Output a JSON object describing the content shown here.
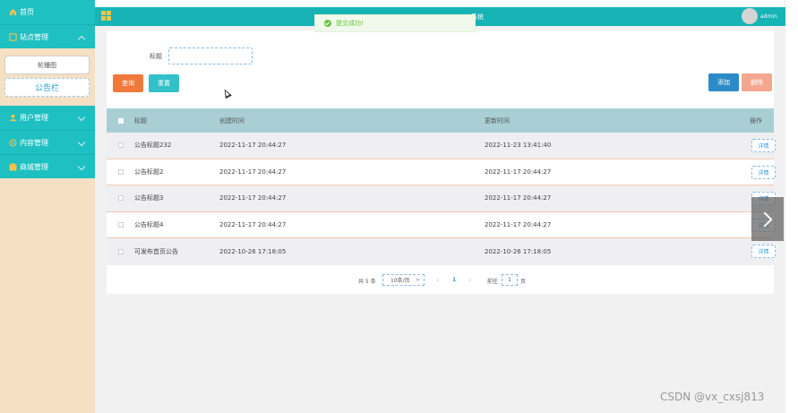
{
  "sidebar": {
    "home": {
      "label": "首页",
      "icon": "home-icon"
    },
    "site_management": {
      "label": "站点管理",
      "icon": "site-icon",
      "expanded": true
    },
    "sub_items": [
      {
        "label": "轮播图",
        "active": false
      },
      {
        "label": "公告栏",
        "active": true
      }
    ],
    "user_management": {
      "label": "用户管理",
      "icon": "user-icon"
    },
    "content_management": {
      "label": "内容管理",
      "icon": "content-icon"
    },
    "mall_management": {
      "label": "商城管理",
      "icon": "mall-icon"
    }
  },
  "header": {
    "title": "系统",
    "username": "admin"
  },
  "toast": {
    "message": "提交成功!",
    "color": "#67c23a"
  },
  "search": {
    "label": "标题",
    "value": ""
  },
  "buttons": {
    "query": "查询",
    "reset": "重置",
    "add": "添加",
    "delete": "删除"
  },
  "table": {
    "headers": {
      "title": "标题",
      "created": "创建时间",
      "updated": "更新时间",
      "action": "操作"
    },
    "rows": [
      {
        "title": "公告标题232",
        "created": "2022-11-17 20:44:27",
        "updated": "2022-11-23 13:41:40",
        "action": "详情"
      },
      {
        "title": "公告标题2",
        "created": "2022-11-17 20:44:27",
        "updated": "2022-11-17 20:44:27",
        "action": "详情"
      },
      {
        "title": "公告标题3",
        "created": "2022-11-17 20:44:27",
        "updated": "2022-11-17 20:44:27",
        "action": "详情"
      },
      {
        "title": "公告标题4",
        "created": "2022-11-17 20:44:27",
        "updated": "2022-11-17 20:44:27",
        "action": "详情"
      },
      {
        "title": "可发布首页公告",
        "created": "2022-10-26 17:18:05",
        "updated": "2022-10-26 17:18:05",
        "action": "详情"
      }
    ]
  },
  "pagination": {
    "total": "共 5 条",
    "page_size": "10条/页",
    "prev": "‹",
    "current": "1",
    "next": "›",
    "goto_label": "前往",
    "goto_value": "1",
    "unit": "页"
  },
  "colors": {
    "accent": "#1fc0c2",
    "sidebar_bg": "#f5e0c3",
    "table_header": "#a9cfd5"
  },
  "watermark": "CSDN @vx_cxsj813"
}
